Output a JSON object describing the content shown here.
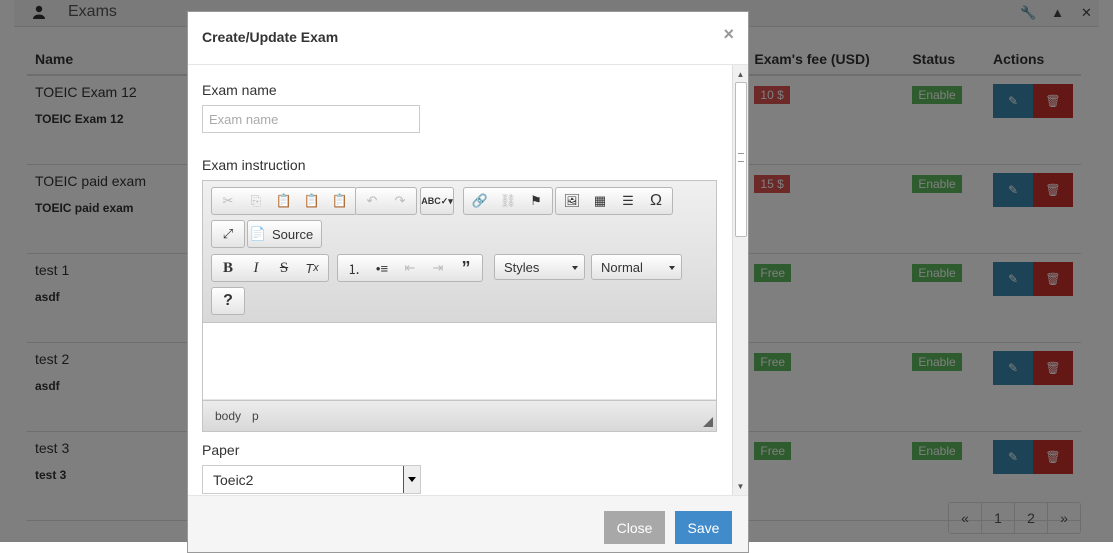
{
  "panel": {
    "title": "Exams",
    "tools": {
      "wrench": "🔧",
      "up": "▲",
      "close": "✕"
    }
  },
  "table": {
    "headers": [
      "Name",
      "Exam's fee (USD)",
      "Status",
      "Actions"
    ],
    "rows": [
      {
        "name": "TOEIC Exam 12",
        "sub": "TOEIC Exam 12",
        "fee": "10 $",
        "status": "Enable"
      },
      {
        "name": "TOEIC paid exam",
        "sub": "TOEIC paid exam",
        "fee": "15 $",
        "status": "Enable"
      },
      {
        "name": "test 1",
        "sub": "asdf",
        "fee": "Free",
        "status": "Enable"
      },
      {
        "name": "test 2",
        "sub": "asdf",
        "fee": "Free",
        "status": "Enable"
      },
      {
        "name": "test 3",
        "sub": "test 3",
        "fee": "Free",
        "status": "Enable"
      }
    ]
  },
  "pagination": {
    "prev": "«",
    "pages": [
      "1",
      "2"
    ],
    "next": "»"
  },
  "modal": {
    "title": "Create/Update Exam",
    "close_glyph": "×",
    "exam_name": {
      "label": "Exam name",
      "placeholder": "Exam name",
      "value": ""
    },
    "exam_instruction": {
      "label": "Exam instruction",
      "source_label": "Source",
      "styles_label": "Styles",
      "format_label": "Normal",
      "path": [
        "body",
        "p"
      ],
      "help_glyph": "?"
    },
    "paper": {
      "label": "Paper",
      "selected": "Toeic2"
    },
    "buttons": {
      "close": "Close",
      "save": "Save"
    }
  }
}
